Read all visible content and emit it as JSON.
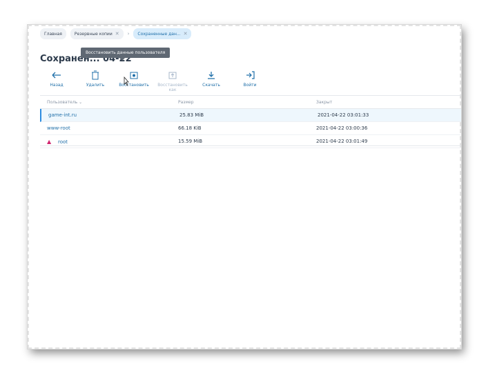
{
  "breadcrumbs": [
    {
      "label": "Главная"
    },
    {
      "label": "Резервные копии"
    },
    {
      "label": "Сохраненные дан..."
    }
  ],
  "title": "Сохранен... 04-22",
  "tooltip": "Восстановить данные пользователя",
  "toolbar": [
    {
      "label": "Назад",
      "icon": "back-arrow-icon"
    },
    {
      "label": "Удалить",
      "icon": "trash-icon"
    },
    {
      "label": "Восстановить",
      "icon": "restore-icon"
    },
    {
      "label": "Восстановить как",
      "icon": "restore-as-icon",
      "disabled": true
    },
    {
      "label": "Скачать",
      "icon": "download-icon"
    },
    {
      "label": "Войти",
      "icon": "login-icon"
    }
  ],
  "table": {
    "headers": [
      "Пользователь",
      "Размер",
      "Закрыт"
    ],
    "rows": [
      {
        "user": "game-int.ru",
        "size": "25.83 MiB",
        "closed": "2021-04-22 03:01:33",
        "selected": true
      },
      {
        "user": "www-root",
        "size": "66.18 KiB",
        "closed": "2021-04-22 03:00:36"
      },
      {
        "user": "root",
        "size": "15.59 MiB",
        "closed": "2021-04-22 03:01:49",
        "warning": true
      }
    ]
  }
}
